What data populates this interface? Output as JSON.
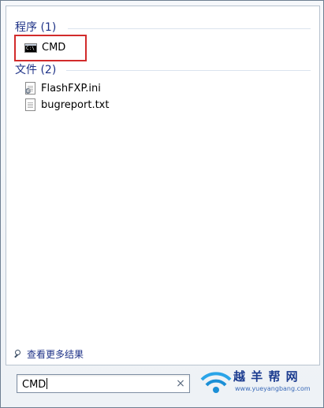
{
  "results": {
    "programs_header": "程序 (1)",
    "programs": [
      {
        "label": "CMD",
        "icon": "cmd-console-icon",
        "highlighted": true
      }
    ],
    "files_header": "文件 (2)",
    "files": [
      {
        "label": "FlashFXP.ini",
        "icon": "ini-config-file-icon"
      },
      {
        "label": "bugreport.txt",
        "icon": "text-file-icon"
      }
    ]
  },
  "see_more": {
    "label": "查看更多结果",
    "icon": "search-icon"
  },
  "search": {
    "value": "CMD",
    "clear_icon": "close-icon",
    "clear_glyph": "×"
  },
  "watermark": {
    "title": "越 羊 帮 网",
    "url": "www.yueyangbang.com"
  },
  "colors": {
    "header_text": "#1e3287",
    "highlight_border": "#d22b2b",
    "panel_background": "#ffffff",
    "frame_background": "#eef2f6"
  }
}
